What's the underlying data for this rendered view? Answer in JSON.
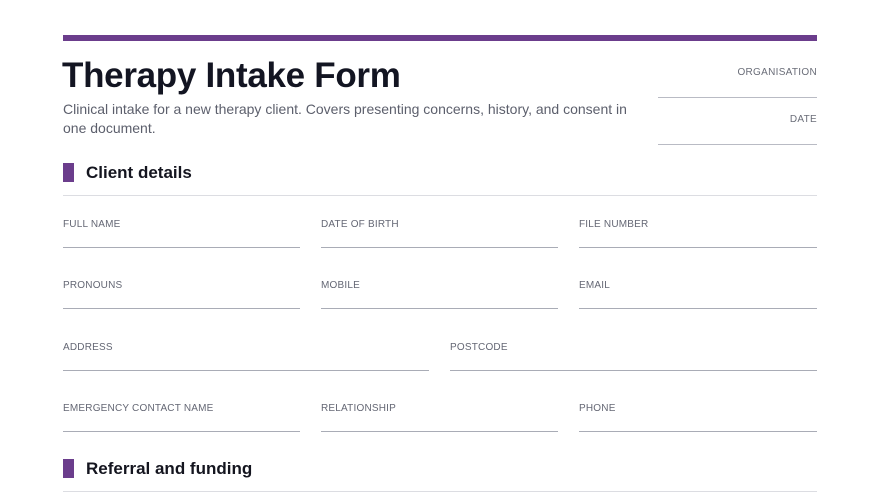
{
  "colors": {
    "accent": "#6b3d8c"
  },
  "form": {
    "title": "Therapy Intake Form",
    "subtitle": "Clinical intake for a new therapy client. Covers presenting concerns, history, and consent in one document.",
    "organisation_label": "ORGANISATION",
    "date_label": "DATE"
  },
  "sections": [
    {
      "title": "Client details",
      "fields": {
        "full_name": "FULL NAME",
        "date_of_birth": "DATE OF BIRTH",
        "file_number": "FILE NUMBER",
        "pronouns": "PRONOUNS",
        "mobile": "MOBILE",
        "email": "EMAIL",
        "address": "ADDRESS",
        "postcode": "POSTCODE",
        "emergency_contact_name": "EMERGENCY CONTACT NAME",
        "relationship": "RELATIONSHIP",
        "phone": "PHONE"
      }
    },
    {
      "title": "Referral and funding"
    }
  ]
}
